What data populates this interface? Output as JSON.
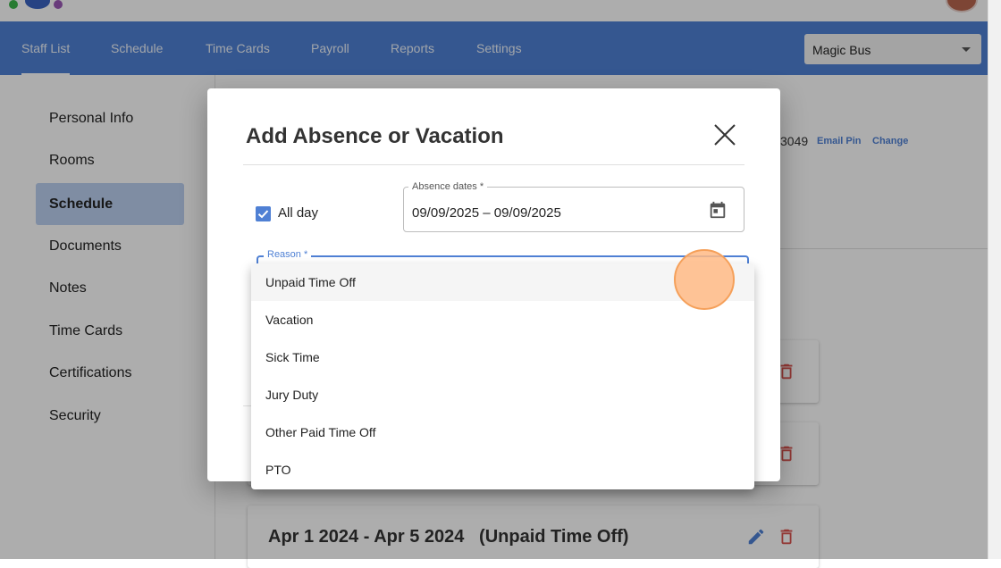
{
  "nav": {
    "tabs": [
      {
        "label": "Staff List"
      },
      {
        "label": "Schedule"
      },
      {
        "label": "Time Cards"
      },
      {
        "label": "Payroll"
      },
      {
        "label": "Reports"
      },
      {
        "label": "Settings"
      }
    ],
    "active_tab": "Staff List",
    "org_select": {
      "value": "Magic Bus"
    }
  },
  "sidebar": {
    "items": [
      {
        "label": "Personal Info"
      },
      {
        "label": "Rooms"
      },
      {
        "label": "Schedule"
      },
      {
        "label": "Documents"
      },
      {
        "label": "Notes"
      },
      {
        "label": "Time Cards"
      },
      {
        "label": "Certifications"
      },
      {
        "label": "Security"
      }
    ],
    "active_item": "Schedule"
  },
  "main": {
    "pin_suffix": "3049",
    "email_pin_label": "Email Pin",
    "change_label": "Change",
    "absence_card_title": "Apr 1 2024 - Apr 5 2024   (Unpaid Time Off)"
  },
  "dialog": {
    "title": "Add Absence or Vacation",
    "all_day": {
      "label": "All day",
      "checked": true
    },
    "absence_dates": {
      "label": "Absence dates *",
      "value": "09/09/2025 – 09/09/2025"
    },
    "reason": {
      "label": "Reason *"
    }
  },
  "reason_menu": {
    "options": [
      {
        "label": "Unpaid Time Off"
      },
      {
        "label": "Vacation"
      },
      {
        "label": "Sick Time"
      },
      {
        "label": "Jury Duty"
      },
      {
        "label": "Other Paid Time Off"
      },
      {
        "label": "PTO"
      }
    ],
    "highlighted": "Unpaid Time Off"
  },
  "colors": {
    "brand": "#4f80d4",
    "sidebar_active": "#bcd0f0",
    "delete_red": "#d9534f",
    "click_indicator": "#ffba85"
  },
  "icons": [
    "calendar-icon",
    "close-icon",
    "pencil-icon",
    "trash-icon",
    "chevron-down-icon",
    "check-icon"
  ]
}
